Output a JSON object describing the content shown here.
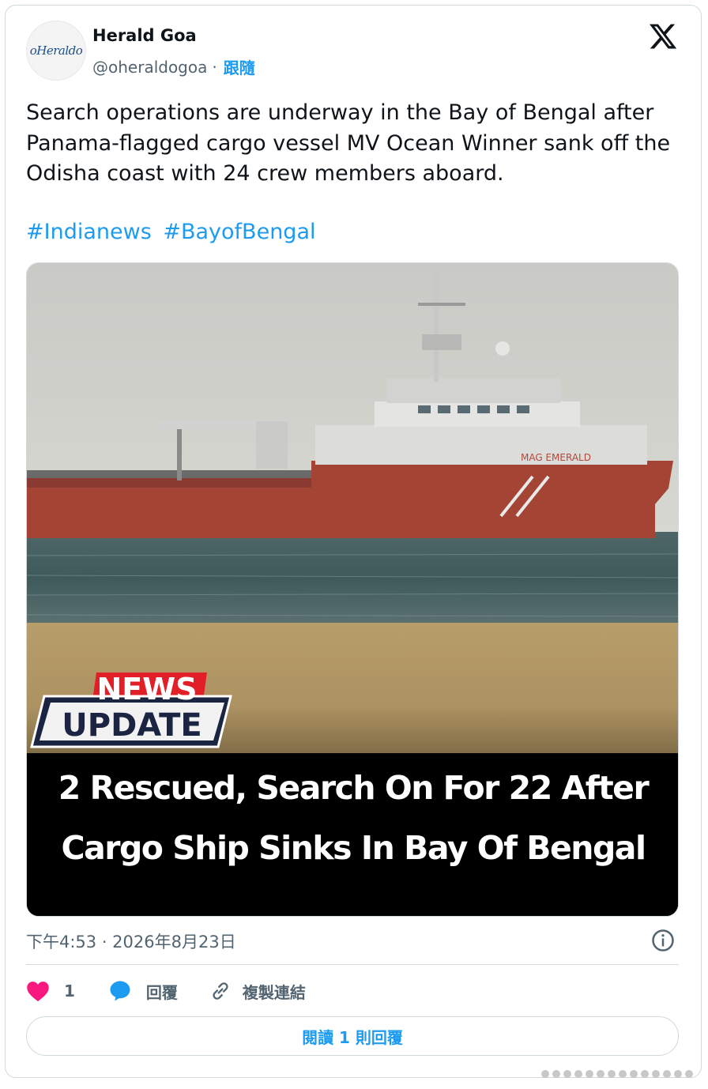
{
  "account": {
    "avatar_text": "oHeraldo",
    "display_name": "Herald Goa",
    "handle": "@oheraldogoa",
    "separator": "·",
    "follow_label": "跟隨"
  },
  "tweet": {
    "text": "Search operations are underway in the Bay of Bengal after Panama-flagged cargo vessel MV Ocean Winner sank off the Odisha coast with 24 crew members aboard.",
    "hashtags": [
      "#Indianews",
      "#BayofBengal"
    ]
  },
  "media": {
    "badge_top": "NEWS",
    "badge_bottom": "UPDATE",
    "ship_name": "MAG EMERALD",
    "headline_line1": "2 Rescued, Search On For 22 After",
    "headline_line2": "Cargo Ship Sinks In Bay Of Bengal"
  },
  "meta": {
    "timestamp": "下午4:53 · 2026年8月23日"
  },
  "actions": {
    "like_count": "1",
    "reply_label": "回覆",
    "copy_link_label": "複製連結",
    "read_replies_label": "閱讀 1 則回覆"
  },
  "colors": {
    "link_blue": "#1d9bf0",
    "like_red": "#f91880",
    "text_primary": "#0f1419",
    "text_secondary": "#536471"
  },
  "icons": [
    "x-logo-icon",
    "info-icon",
    "heart-icon",
    "reply-bubble-icon",
    "link-icon"
  ]
}
